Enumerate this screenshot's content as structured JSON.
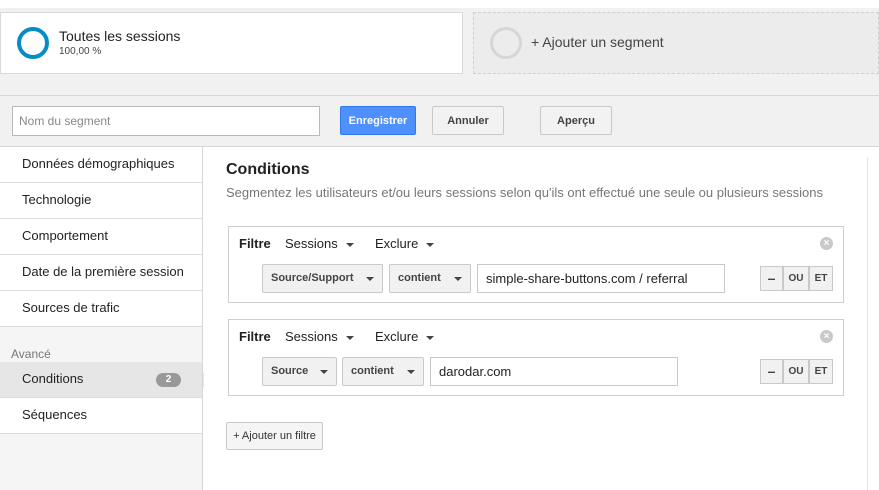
{
  "segments": {
    "current": {
      "title": "Toutes les sessions",
      "percent": "100,00 %"
    },
    "add_label": "+ Ajouter un segment"
  },
  "editor": {
    "name_placeholder": "Nom du segment",
    "save_label": "Enregistrer",
    "cancel_label": "Annuler",
    "preview_label": "Aperçu"
  },
  "sidebar": {
    "items": [
      {
        "label": "Données démographiques"
      },
      {
        "label": "Technologie"
      },
      {
        "label": "Comportement"
      },
      {
        "label": "Date de la première session"
      },
      {
        "label": "Sources de trafic"
      }
    ],
    "advanced_label": "Avancé",
    "advanced_items": [
      {
        "label": "Conditions",
        "badge": "2",
        "active": true
      },
      {
        "label": "Séquences"
      }
    ]
  },
  "main": {
    "title": "Conditions",
    "subtitle": "Segmentez les utilisateurs et/ou leurs sessions selon qu'ils ont effectué une seule ou plusieurs sessions",
    "filters": [
      {
        "label": "Filtre",
        "scope": "Sessions",
        "mode": "Exclure",
        "dimension": "Source/Support",
        "operator": "contient",
        "value": "simple-share-buttons.com / referral",
        "ops": {
          "minus": "–",
          "or": "OU",
          "and": "ET"
        }
      },
      {
        "label": "Filtre",
        "scope": "Sessions",
        "mode": "Exclure",
        "dimension": "Source",
        "operator": "contient",
        "value": "darodar.com",
        "ops": {
          "minus": "–",
          "or": "OU",
          "and": "ET"
        }
      }
    ],
    "add_filter_label": "+ Ajouter un filtre"
  },
  "colors": {
    "accent_blue": "#4d90fe",
    "segment_ring": "#058dc7",
    "badge_gray": "#999999"
  }
}
